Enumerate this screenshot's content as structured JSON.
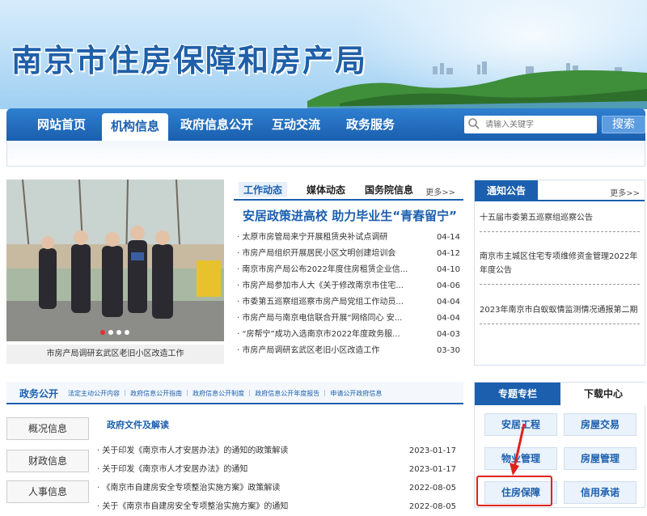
{
  "header": {
    "title": "南京市住房保障和房产局"
  },
  "nav": {
    "items": [
      "网站首页",
      "机构信息",
      "政府信息公开",
      "互动交流",
      "政务服务"
    ],
    "active_index": 1,
    "search_placeholder": "请输入关键字",
    "search_button": "搜索"
  },
  "photo": {
    "caption": "市房产局调研玄武区老旧小区改造工作"
  },
  "news": {
    "tabs": [
      "工作动态",
      "媒体动态",
      "国务院信息"
    ],
    "more": "更多>>",
    "headline": "安居政策进高校 助力毕业生“青春留宁”",
    "items": [
      {
        "text": "· 太原市房管局来宁开展租赁央补试点调研",
        "date": "04-14"
      },
      {
        "text": "· 市房产局组织开展居民小区文明创建培训会",
        "date": "04-12"
      },
      {
        "text": "· 南京市房产局公布2022年度住房租赁企业信...",
        "date": "04-10"
      },
      {
        "text": "· 市房产局参加市人大《关于修改南京市住宅...",
        "date": "04-06"
      },
      {
        "text": "· 市委第五巡察组巡察市房产局党组工作动员...",
        "date": "04-04"
      },
      {
        "text": "· 市房产局与南京电信联合开展“网络同心 安...",
        "date": "04-04"
      },
      {
        "text": "· “房帮宁”成功入选南京市2022年度政务服...",
        "date": "04-03"
      },
      {
        "text": "· 市房产局调研玄武区老旧小区改造工作",
        "date": "03-30"
      }
    ]
  },
  "notice": {
    "title": "通知公告",
    "more": "更多>>",
    "items": [
      "十五届市委第五巡察组巡察公告",
      "南京市主城区住宅专项维修资金管理2022年年度公告",
      "2023年南京市白蚁蚁情监测情况通报第二期"
    ]
  },
  "gov": {
    "title": "政务公开",
    "links": "法定主动公开内容 ｜ 政府信息公开指南 ｜ 政府信息公开制度 ｜ 政府信息公开年度报告 ｜ 申请公开政府信息",
    "side": [
      "概况信息",
      "财政信息",
      "人事信息"
    ],
    "subhead": "政府文件及解读",
    "items": [
      {
        "text": "· 关于印发《南京市人才安居办法》的通知的政策解读",
        "date": "2023-01-17"
      },
      {
        "text": "· 关于印发《南京市人才安居办法》的通知",
        "date": "2023-01-17"
      },
      {
        "text": "· 《南京市自建房安全专项整治实施方案》政策解读",
        "date": "2022-08-05"
      },
      {
        "text": "· 关于《南京市自建房安全专项整治实施方案》的通知",
        "date": "2022-08-05"
      }
    ]
  },
  "topics": {
    "tabs": [
      "专题专栏",
      "下载中心"
    ],
    "buttons": [
      "安居工程",
      "房屋交易",
      "物业管理",
      "房屋管理",
      "住房保障",
      "信用承诺"
    ],
    "highlighted": "住房保障"
  }
}
